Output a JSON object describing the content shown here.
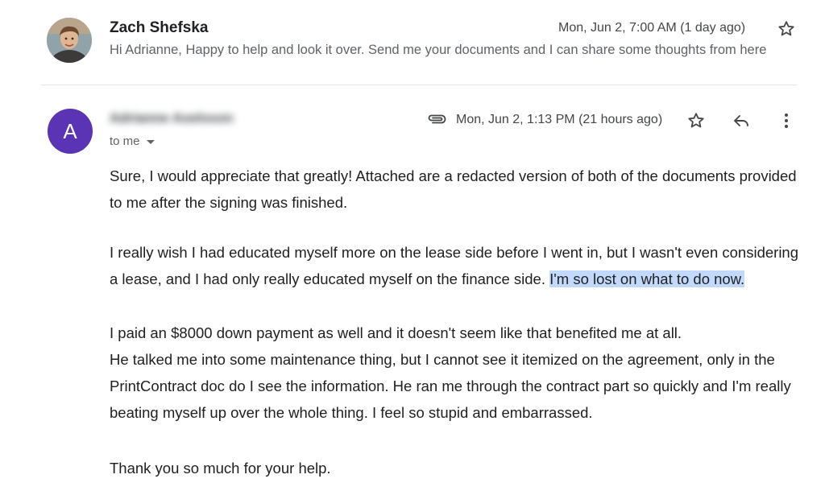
{
  "messages": [
    {
      "sender": "Zach Shefska",
      "date": "Mon, Jun 2, 7:00 AM (1 day ago)",
      "snippet": "Hi Adrianne, Happy to help and look it over. Send me your documents and I can share some thoughts from here",
      "avatar_icon": "profile-photo"
    },
    {
      "sender": "Adrianne Axelsson",
      "avatar_letter": "A",
      "avatar_color": "#5b33b5",
      "recipient": "to me",
      "date": "Mon, Jun 2, 1:13 PM (21 hours ago)",
      "has_attachment": true,
      "body": {
        "p1": [
          "Sure, I would appreciate that greatly! Attached are a redacted version of both of the documents provided",
          "to me after the signing was finished."
        ],
        "p2_line1": "I really wish I had educated myself more on the lease side before I went in, but I wasn't even considering",
        "p2_line2_plain": "a lease, and I had only really educated myself on the finance side. ",
        "p2_line2_highlight": "I'm so lost on what to do now.",
        "p3": [
          "I paid an $8000 down payment as well and it doesn't seem like that benefited me at all.",
          "He talked me into some maintenance thing, but I cannot see it itemized on the agreement, only in the",
          "PrintContract doc do I see the information. He ran me through the contract part so quickly and I'm really",
          "beating myself up over the whole thing. I feel so stupid and embarrassed."
        ],
        "p4": "Thank you so much for your help."
      }
    }
  ],
  "colors": {
    "highlight": "#c3d9fb",
    "text": "#1f1f1f",
    "muted": "#5f6368"
  }
}
